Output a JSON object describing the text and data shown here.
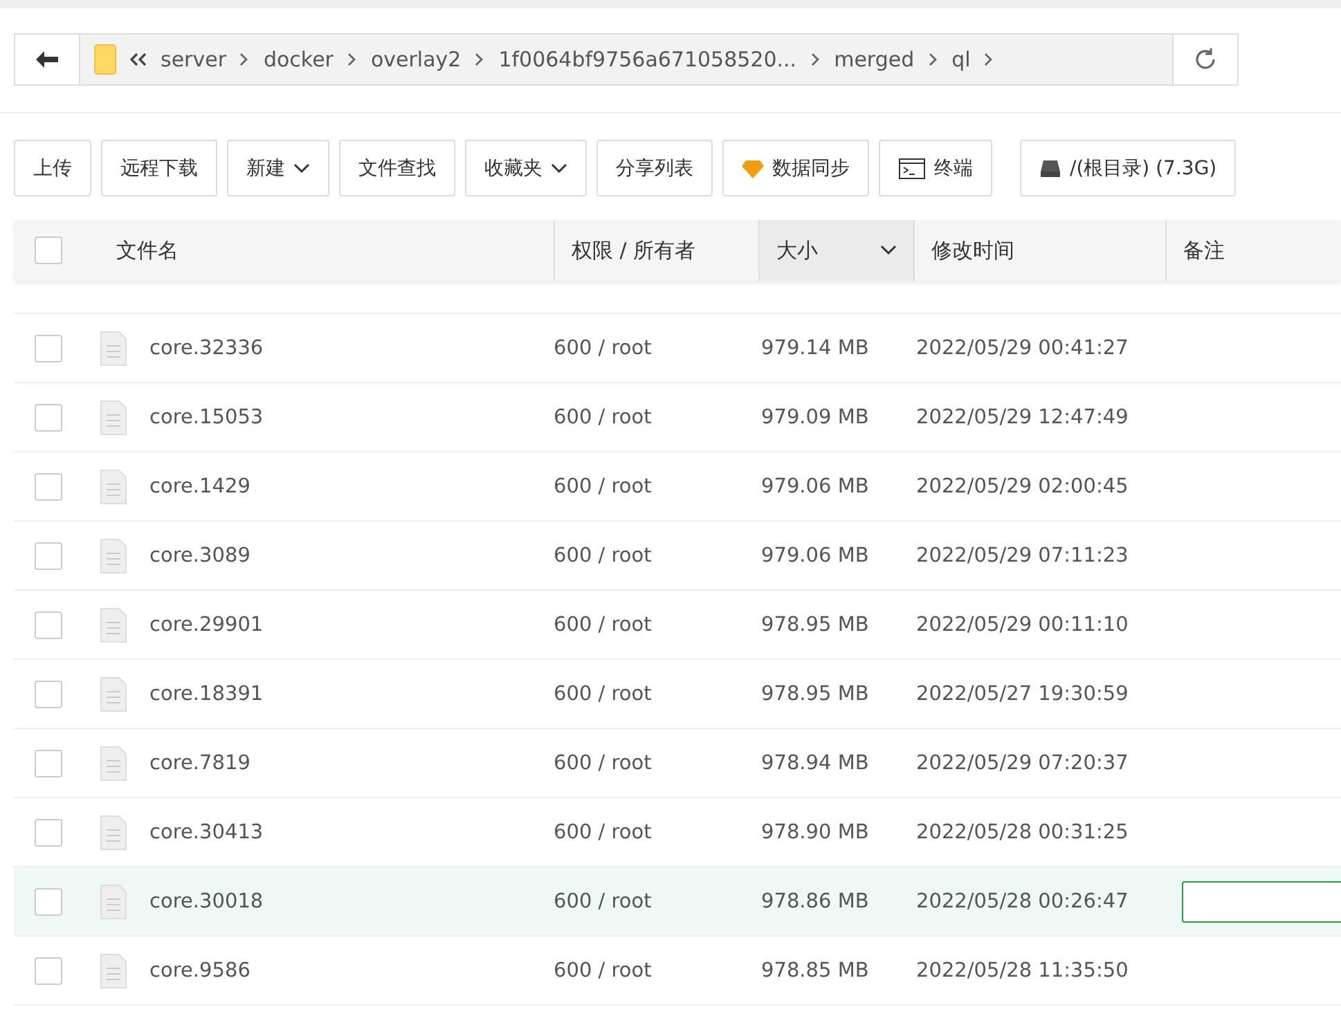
{
  "breadcrumb": [
    "server",
    "docker",
    "overlay2",
    "1f0064bf9756a671058520...",
    "merged",
    "ql"
  ],
  "toolbar": [
    {
      "label": "上传",
      "kind": "plain"
    },
    {
      "label": "远程下载",
      "kind": "plain"
    },
    {
      "label": "新建",
      "kind": "dropdown"
    },
    {
      "label": "文件查找",
      "kind": "plain"
    },
    {
      "label": "收藏夹",
      "kind": "dropdown"
    },
    {
      "label": "分享列表",
      "kind": "plain"
    },
    {
      "label": "数据同步",
      "kind": "gem"
    },
    {
      "label": "终端",
      "kind": "terminal"
    },
    {
      "label": "/(根目录) (7.3G)",
      "kind": "disk"
    }
  ],
  "table": {
    "select_all": {
      "checked": false
    },
    "columns": [
      {
        "label": "文件名",
        "sorted": false
      },
      {
        "label": "权限 / 所有者",
        "sorted": false
      },
      {
        "label": "大小",
        "sorted": true
      },
      {
        "label": "修改时间",
        "sorted": false
      },
      {
        "label": "备注",
        "sorted": false
      }
    ],
    "rows": [
      {
        "name": "core.32336",
        "perm": "600 / root",
        "size": "979.14 MB",
        "time": "2022/05/29 00:41:27",
        "selected": false,
        "editing": false,
        "checked": false
      },
      {
        "name": "core.15053",
        "perm": "600 / root",
        "size": "979.09 MB",
        "time": "2022/05/29 12:47:49",
        "selected": false,
        "editing": false,
        "checked": false
      },
      {
        "name": "core.1429",
        "perm": "600 / root",
        "size": "979.06 MB",
        "time": "2022/05/29 02:00:45",
        "selected": false,
        "editing": false,
        "checked": false
      },
      {
        "name": "core.3089",
        "perm": "600 / root",
        "size": "979.06 MB",
        "time": "2022/05/29 07:11:23",
        "selected": false,
        "editing": false,
        "checked": false
      },
      {
        "name": "core.29901",
        "perm": "600 / root",
        "size": "978.95 MB",
        "time": "2022/05/29 00:11:10",
        "selected": false,
        "editing": false,
        "checked": false
      },
      {
        "name": "core.18391",
        "perm": "600 / root",
        "size": "978.95 MB",
        "time": "2022/05/27 19:30:59",
        "selected": false,
        "editing": false,
        "checked": false
      },
      {
        "name": "core.7819",
        "perm": "600 / root",
        "size": "978.94 MB",
        "time": "2022/05/29 07:20:37",
        "selected": false,
        "editing": false,
        "checked": false
      },
      {
        "name": "core.30413",
        "perm": "600 / root",
        "size": "978.90 MB",
        "time": "2022/05/28 00:31:25",
        "selected": false,
        "editing": false,
        "checked": false
      },
      {
        "name": "core.30018",
        "perm": "600 / root",
        "size": "978.86 MB",
        "time": "2022/05/28 00:26:47",
        "selected": true,
        "editing": true,
        "checked": false
      },
      {
        "name": "core.9586",
        "perm": "600 / root",
        "size": "978.85 MB",
        "time": "2022/05/28 11:35:50",
        "selected": false,
        "editing": false,
        "checked": false
      }
    ]
  }
}
